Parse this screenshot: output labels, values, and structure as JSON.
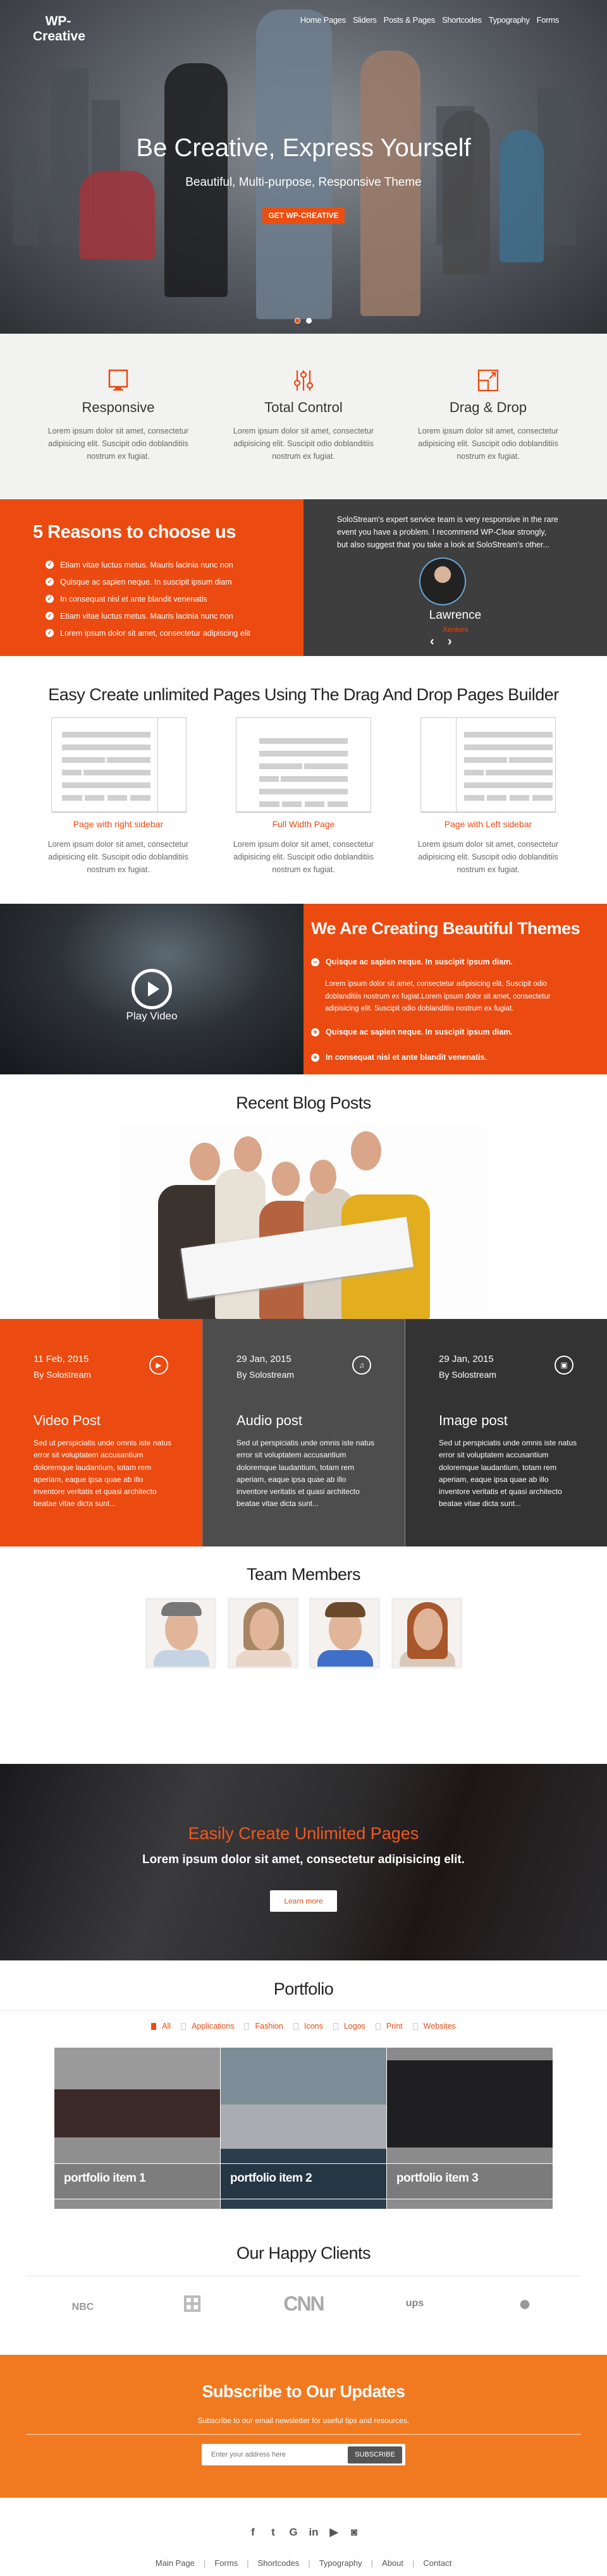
{
  "colors": {
    "accent": "#eb4a10",
    "dark": "#3e3e3e",
    "subscribe_bg": "#f17a21"
  },
  "header": {
    "logo": "WP-Creative",
    "nav": [
      "Home Pages",
      "Sliders",
      "Posts & Pages",
      "Shortcodes",
      "Typography",
      "Forms"
    ]
  },
  "hero": {
    "headline": "Be Creative, Express Yourself",
    "subtitle": "Beautiful, Multi-purpose, Responsive Theme",
    "button": "GET WP-CREATIVE",
    "slides": 2,
    "active_slide": 1
  },
  "features": [
    {
      "icon": "monitor-icon",
      "title": "Responsive",
      "text": "Lorem ipsum dolor sit amet, consectetur adipisicing elit. Suscipit odio doblanditiis nostrum ex fugiat."
    },
    {
      "icon": "sliders-icon",
      "title": "Total Control",
      "text": "Lorem ipsum dolor sit amet, consectetur adipisicing elit. Suscipit odio doblanditiis nostrum ex fugiat."
    },
    {
      "icon": "resize-icon",
      "title": "Drag & Drop",
      "text": "Lorem ipsum dolor sit amet, consectetur adipisicing elit. Suscipit odio doblanditiis nostrum ex fugiat."
    }
  ],
  "reasons": {
    "title": "5 Reasons to choose us",
    "items": [
      "Etiam vitae luctus metus. Mauris lacinia nunc non",
      "Quisque ac sapien neque. In suscipit ipsum diam",
      "In consequat nisl et ante blandit venenatis",
      "Etiam vitae luctus metus. Mauris lacinia nunc non",
      "Lorem ipsum dolor sit amet, consectetur adipiscing elit"
    ]
  },
  "testimonial": {
    "quote": "SoloStream's expert service team is very responsive in the rare event you have a problem. I recommend WP-Clear strongly, but also suggest that you take a look at SoloStream's other...",
    "name": "Lawrence",
    "role": "Xeniors"
  },
  "builder": {
    "title": "Easy Create unlimited Pages Using The Drag And Drop Pages Builder",
    "pages": [
      {
        "label": "Page with right sidebar",
        "text": "Lorem ipsum dolor sit amet, consectetur adipisicing elit. Suscipit odio doblanditiis nostrum ex fugiat."
      },
      {
        "label": "Full Width Page",
        "text": "Lorem ipsum dolor sit amet, consectetur adipisicing elit. Suscipit odio doblanditiis nostrum ex fugiat."
      },
      {
        "label": "Page with Left sidebar",
        "text": "Lorem ipsum dolor sit amet, consectetur adipisicing elit. Suscipit odio doblanditiis nostrum ex fugiat."
      }
    ]
  },
  "video": {
    "play_label": "Play Video",
    "title": "We Are Creating Beautiful Themes",
    "accordion": [
      {
        "title": "Quisque ac sapien neque. In suscipit ipsum diam.",
        "open": true,
        "body": "Lorem ipsum dolor sit amet, consectetur adipisicing elit. Suscipit odio doblanditiis nostrum ex fugiat.Lorem ipsum dolor sit amet, consectetur adipisicing elit. Suscipit odio doblanditiis nostrum ex fugiat."
      },
      {
        "title": "Quisque ac sapien neque. In suscipit ipsum diam.",
        "open": false
      },
      {
        "title": "In consequat nisl et ante blandit venenatis.",
        "open": false
      }
    ]
  },
  "blog": {
    "title": "Recent Blog Posts",
    "posts": [
      {
        "date": "11 Feb, 2015",
        "author": "By Solostream",
        "icon": "play-icon",
        "title": "Video Post",
        "text": "Sed ut perspiciatis unde omnis iste natus error sit voluptatem accusantium doloremque laudantium, totam rem aperiam, eaque ipsa quae ab illo inventore veritatis et quasi architecto beatae vitae dicta sunt...",
        "bg": "#eb4a10"
      },
      {
        "date": "29 Jan, 2015",
        "author": "By Solostream",
        "icon": "music-icon",
        "title": "Audio post",
        "text": "Sed ut perspiciatis unde omnis iste natus error sit voluptatem accusantium doloremque laudantium, totam rem aperiam, eaque ipsa quae ab illo inventore veritatis et quasi architecto beatae vitae dicta sunt...",
        "bg": "#4d4d4d"
      },
      {
        "date": "29 Jan, 2015",
        "author": "By Solostream",
        "icon": "image-icon",
        "title": "Image post",
        "text": "Sed ut perspiciatis unde omnis iste natus error sit voluptatem accusantium doloremque laudantium, totam rem aperiam, eaque ipsa quae ab illo inventore veritatis et quasi architecto beatae vitae dicta sunt...",
        "bg": "#333333"
      }
    ]
  },
  "team": {
    "title": "Team Members",
    "count": 4
  },
  "cta": {
    "title": "Easily Create Unlimited Pages",
    "subtitle": "Lorem ipsum dolor sit amet, consectetur adipisicing elit.",
    "button": "Learn more"
  },
  "portfolio": {
    "title": "Portfolio",
    "filters": [
      {
        "label": "All",
        "active": true
      },
      {
        "label": "Applications"
      },
      {
        "label": "Fashion"
      },
      {
        "label": "Icons"
      },
      {
        "label": "Logos"
      },
      {
        "label": "Print"
      },
      {
        "label": "Websites"
      }
    ],
    "items": [
      "portfolio item 1",
      "portfolio item 2",
      "portfolio item 3"
    ]
  },
  "clients": {
    "title": "Our Happy Clients",
    "logos": [
      "NBC",
      "Windows",
      "CNN",
      "ups",
      "Apple"
    ]
  },
  "subscribe": {
    "title": "Subscribe to Our Updates",
    "subtitle": "Subscribe to our email newsletter for useful tips and resources.",
    "placeholder": "Enter your address here",
    "button": "SUBSCRIBE"
  },
  "footer": {
    "social": [
      "facebook-icon",
      "twitter-icon",
      "google-icon",
      "linkedin-icon",
      "youtube-icon",
      "instagram-icon"
    ],
    "links": [
      "Main Page",
      "Forms",
      "Shortcodes",
      "Typography",
      "About",
      "Contact"
    ]
  }
}
